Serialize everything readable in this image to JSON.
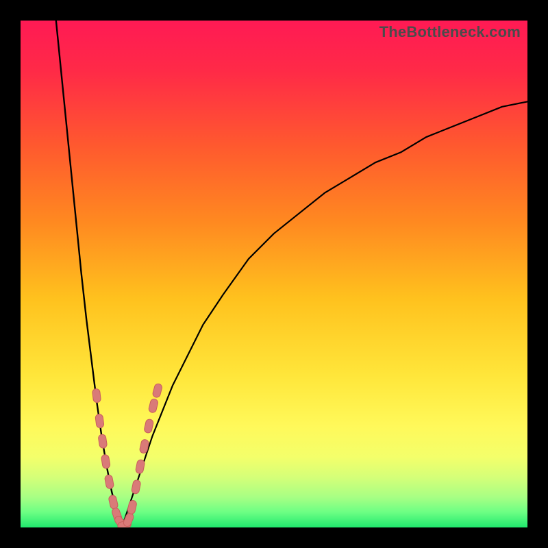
{
  "watermark": "TheBottleneck.com",
  "colors": {
    "frame": "#000000",
    "gradient_stops": [
      {
        "offset": 0.0,
        "color": "#ff1a54"
      },
      {
        "offset": 0.1,
        "color": "#ff2a47"
      },
      {
        "offset": 0.25,
        "color": "#ff5a2e"
      },
      {
        "offset": 0.4,
        "color": "#ff8a20"
      },
      {
        "offset": 0.55,
        "color": "#ffc21e"
      },
      {
        "offset": 0.7,
        "color": "#ffe63a"
      },
      {
        "offset": 0.8,
        "color": "#fff95a"
      },
      {
        "offset": 0.86,
        "color": "#f4ff6a"
      },
      {
        "offset": 0.9,
        "color": "#d6ff78"
      },
      {
        "offset": 0.94,
        "color": "#a8ff84"
      },
      {
        "offset": 0.97,
        "color": "#6cff84"
      },
      {
        "offset": 1.0,
        "color": "#20e86e"
      }
    ],
    "curve_stroke": "#000000",
    "marker_fill": "#d97a78",
    "marker_stroke": "#c95f5d"
  },
  "chart_data": {
    "type": "line",
    "title": "",
    "xlabel": "",
    "ylabel": "",
    "xlim": [
      0,
      100
    ],
    "ylim": [
      0,
      100
    ],
    "notes": "V-shaped bottleneck curve. y reaches 0 (optimal) near x≈20. Left branch rises sharply to y≈100 at x≈7. Right branch rises and approaches y≈84 as x→100.",
    "series": [
      {
        "name": "left-branch",
        "x": [
          7,
          8,
          9,
          10,
          11,
          12,
          13,
          14,
          15,
          16,
          17,
          18,
          19,
          20
        ],
        "y": [
          100,
          90,
          80,
          70,
          60,
          50,
          41,
          33,
          25,
          18,
          12,
          7,
          3,
          0
        ]
      },
      {
        "name": "right-branch",
        "x": [
          20,
          22,
          24,
          26,
          28,
          30,
          33,
          36,
          40,
          45,
          50,
          55,
          60,
          65,
          70,
          75,
          80,
          85,
          90,
          95,
          100
        ],
        "y": [
          0,
          6,
          12,
          18,
          23,
          28,
          34,
          40,
          46,
          53,
          58,
          62,
          66,
          69,
          72,
          74,
          77,
          79,
          81,
          83,
          84
        ]
      }
    ],
    "markers": {
      "name": "highlighted-points",
      "comment": "Pink lozenge markers clustered near the valley on both branches",
      "points": [
        {
          "x": 15.0,
          "y": 26
        },
        {
          "x": 15.6,
          "y": 21
        },
        {
          "x": 16.2,
          "y": 17
        },
        {
          "x": 16.8,
          "y": 13
        },
        {
          "x": 17.5,
          "y": 9
        },
        {
          "x": 18.3,
          "y": 5
        },
        {
          "x": 19.0,
          "y": 2.5
        },
        {
          "x": 19.7,
          "y": 1
        },
        {
          "x": 20.5,
          "y": 0.5
        },
        {
          "x": 21.3,
          "y": 1.5
        },
        {
          "x": 22.0,
          "y": 4
        },
        {
          "x": 22.8,
          "y": 8
        },
        {
          "x": 23.6,
          "y": 12
        },
        {
          "x": 24.4,
          "y": 16
        },
        {
          "x": 25.3,
          "y": 20
        },
        {
          "x": 26.2,
          "y": 24
        },
        {
          "x": 27.0,
          "y": 27
        }
      ]
    }
  }
}
